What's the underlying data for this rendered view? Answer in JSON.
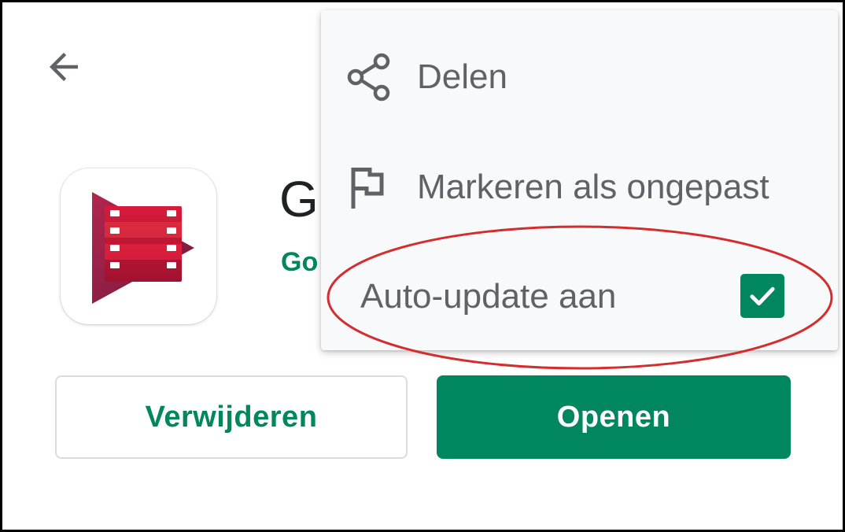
{
  "header": {
    "back_icon": "arrow-back-icon"
  },
  "app": {
    "icon": "google-play-movies-icon",
    "title": "G",
    "developer": "Go"
  },
  "menu": {
    "items": [
      {
        "icon": "share-icon",
        "label": "Delen"
      },
      {
        "icon": "flag-icon",
        "label": "Markeren als ongepast"
      },
      {
        "label": "Auto-update aan",
        "checked": true
      }
    ]
  },
  "buttons": {
    "uninstall": "Verwijderen",
    "open": "Openen"
  },
  "colors": {
    "accent_green": "#01875f",
    "menu_text": "#5f6368",
    "annotation_red": "#d42d2d"
  }
}
